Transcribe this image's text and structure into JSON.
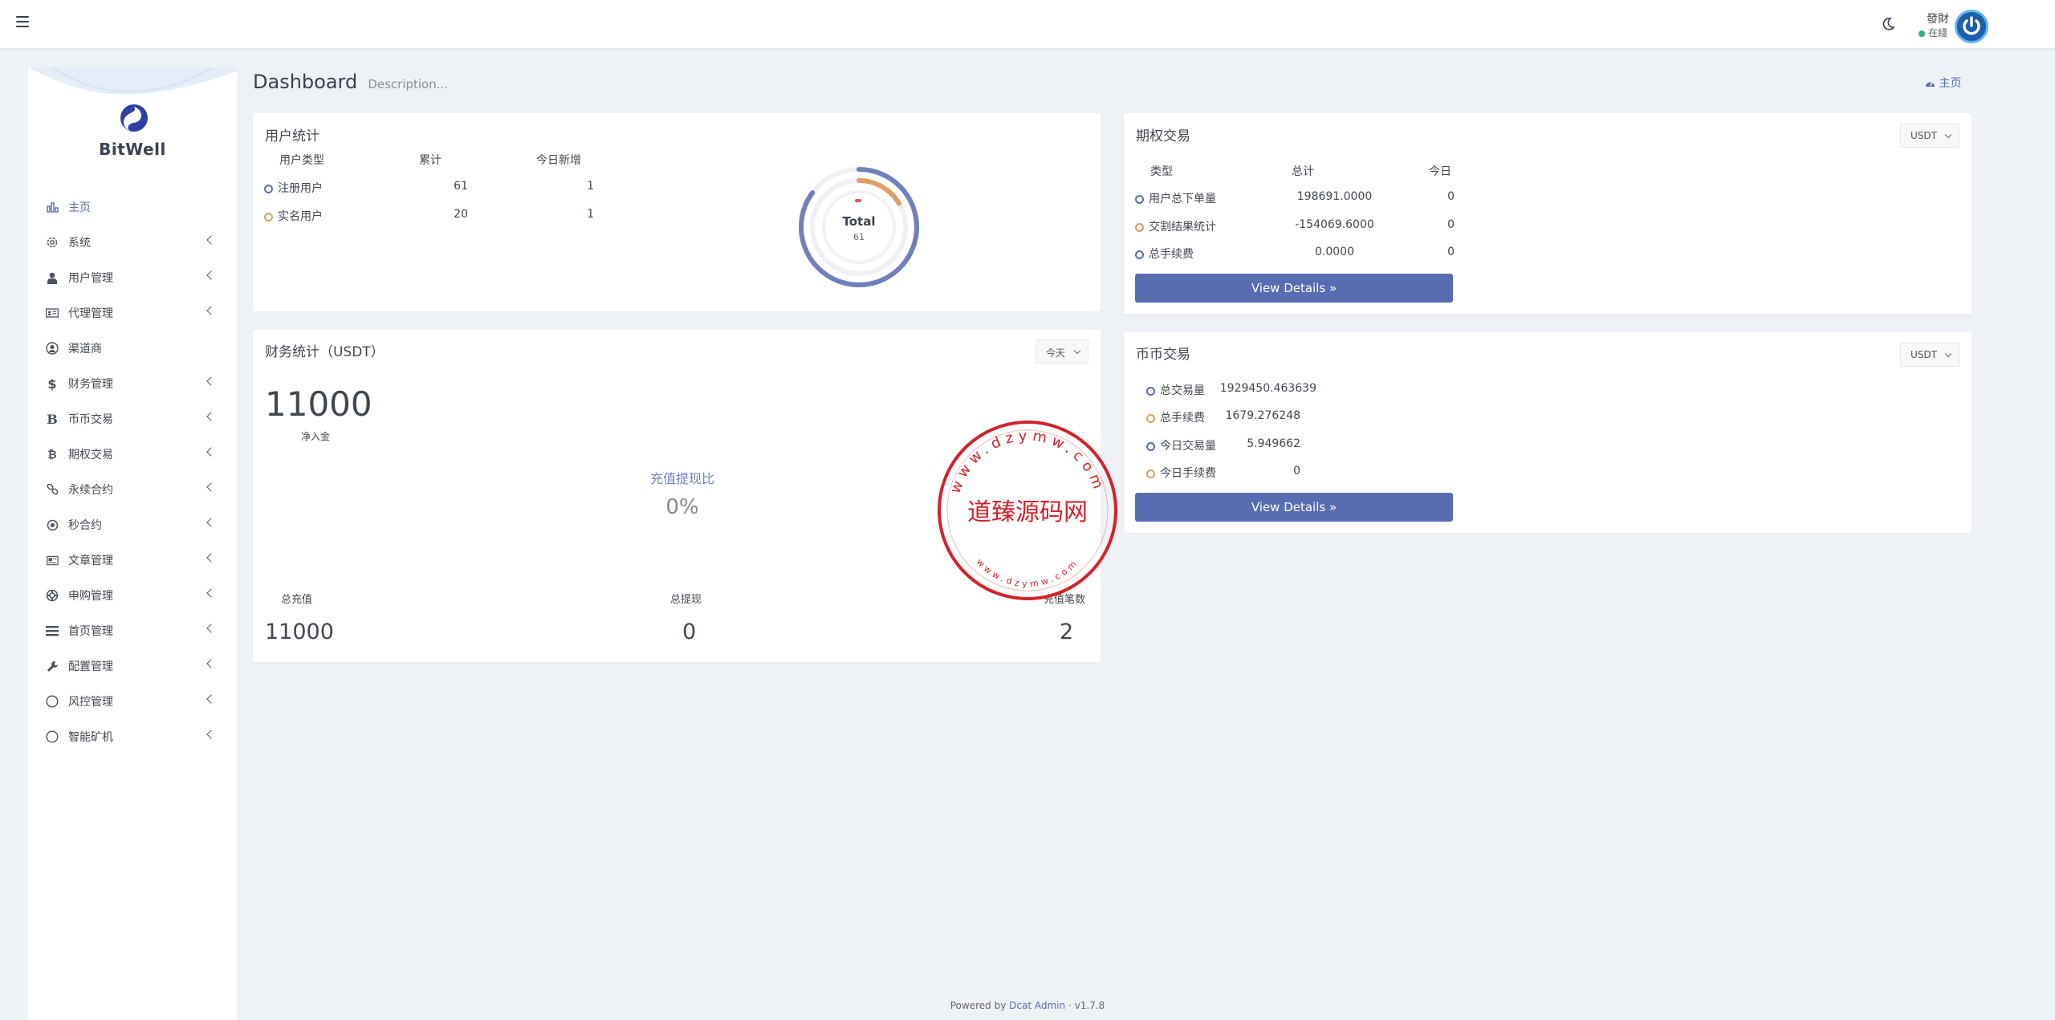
{
  "header": {
    "user_name": "發財",
    "user_status": "在綫"
  },
  "sidebar": {
    "brand": "BitWell",
    "items": [
      {
        "label": "主页",
        "icon": "chart-bar-icon",
        "active": true
      },
      {
        "label": "系统",
        "icon": "gear-icon"
      },
      {
        "label": "用户管理",
        "icon": "user-icon"
      },
      {
        "label": "代理管理",
        "icon": "id-card-icon"
      },
      {
        "label": "渠道商",
        "icon": "user-circle-icon"
      },
      {
        "label": "财务管理",
        "icon": "dollar-icon"
      },
      {
        "label": "币币交易",
        "icon": "bold-b-icon"
      },
      {
        "label": "期权交易",
        "icon": "bitcoin-icon"
      },
      {
        "label": "永续合约",
        "icon": "link-icon"
      },
      {
        "label": "秒合约",
        "icon": "dot-circle-icon"
      },
      {
        "label": "文章管理",
        "icon": "newspaper-icon"
      },
      {
        "label": "申购管理",
        "icon": "life-ring-icon"
      },
      {
        "label": "首页管理",
        "icon": "list-icon"
      },
      {
        "label": "配置管理",
        "icon": "wrench-icon"
      },
      {
        "label": "风控管理",
        "icon": "circle-icon"
      },
      {
        "label": "智能矿机",
        "icon": "circle-icon"
      }
    ]
  },
  "page": {
    "title": "Dashboard",
    "description": "Description...",
    "breadcrumb": "主页"
  },
  "user_stats": {
    "title": "用户统计",
    "headers": [
      "用户类型",
      "累计",
      "今日新增"
    ],
    "rows": [
      {
        "type": "注册用户",
        "total": "61",
        "today": "1"
      },
      {
        "type": "实名用户",
        "total": "20",
        "today": "1"
      }
    ],
    "donut_label": "Total",
    "donut_value": "61"
  },
  "options_trade": {
    "title": "期权交易",
    "currency": "USDT",
    "headers": [
      "类型",
      "总计",
      "今日"
    ],
    "rows": [
      {
        "type": "用户总下单量",
        "total": "198691.0000",
        "today": "0"
      },
      {
        "type": "交割结果统计",
        "total": "-154069.6000",
        "today": "0"
      },
      {
        "type": "总手续费",
        "total": "0.0000",
        "today": "0"
      }
    ],
    "button": "View Details »"
  },
  "finance": {
    "title": "财务统计（USDT）",
    "period": "今天",
    "net_value": "11000",
    "net_label": "净入金",
    "ratio_label": "充值提现比",
    "ratio_value": "0%",
    "stats": [
      {
        "label": "总充值",
        "value": "11000"
      },
      {
        "label": "总提现",
        "value": "0"
      },
      {
        "label": "充值笔数",
        "value": "2"
      }
    ]
  },
  "coin_trade": {
    "title": "币币交易",
    "currency": "USDT",
    "rows": [
      {
        "label": "总交易量",
        "value": "1929450.463639"
      },
      {
        "label": "总手续费",
        "value": "1679.276248"
      },
      {
        "label": "今日交易量",
        "value": "5.949662"
      },
      {
        "label": "今日手续费",
        "value": "0"
      }
    ],
    "button": "View Details »"
  },
  "watermark": {
    "text": "道臻源码网",
    "ring": "www.dzymw.com"
  },
  "footer": {
    "prefix": "Powered by",
    "link": "Dcat Admin",
    "sep": "·",
    "version": "v1.7.8"
  },
  "colors": {
    "primary": "#586cb1",
    "orange": "#dda063",
    "success": "#21b978",
    "stamp": "#d2232a"
  }
}
